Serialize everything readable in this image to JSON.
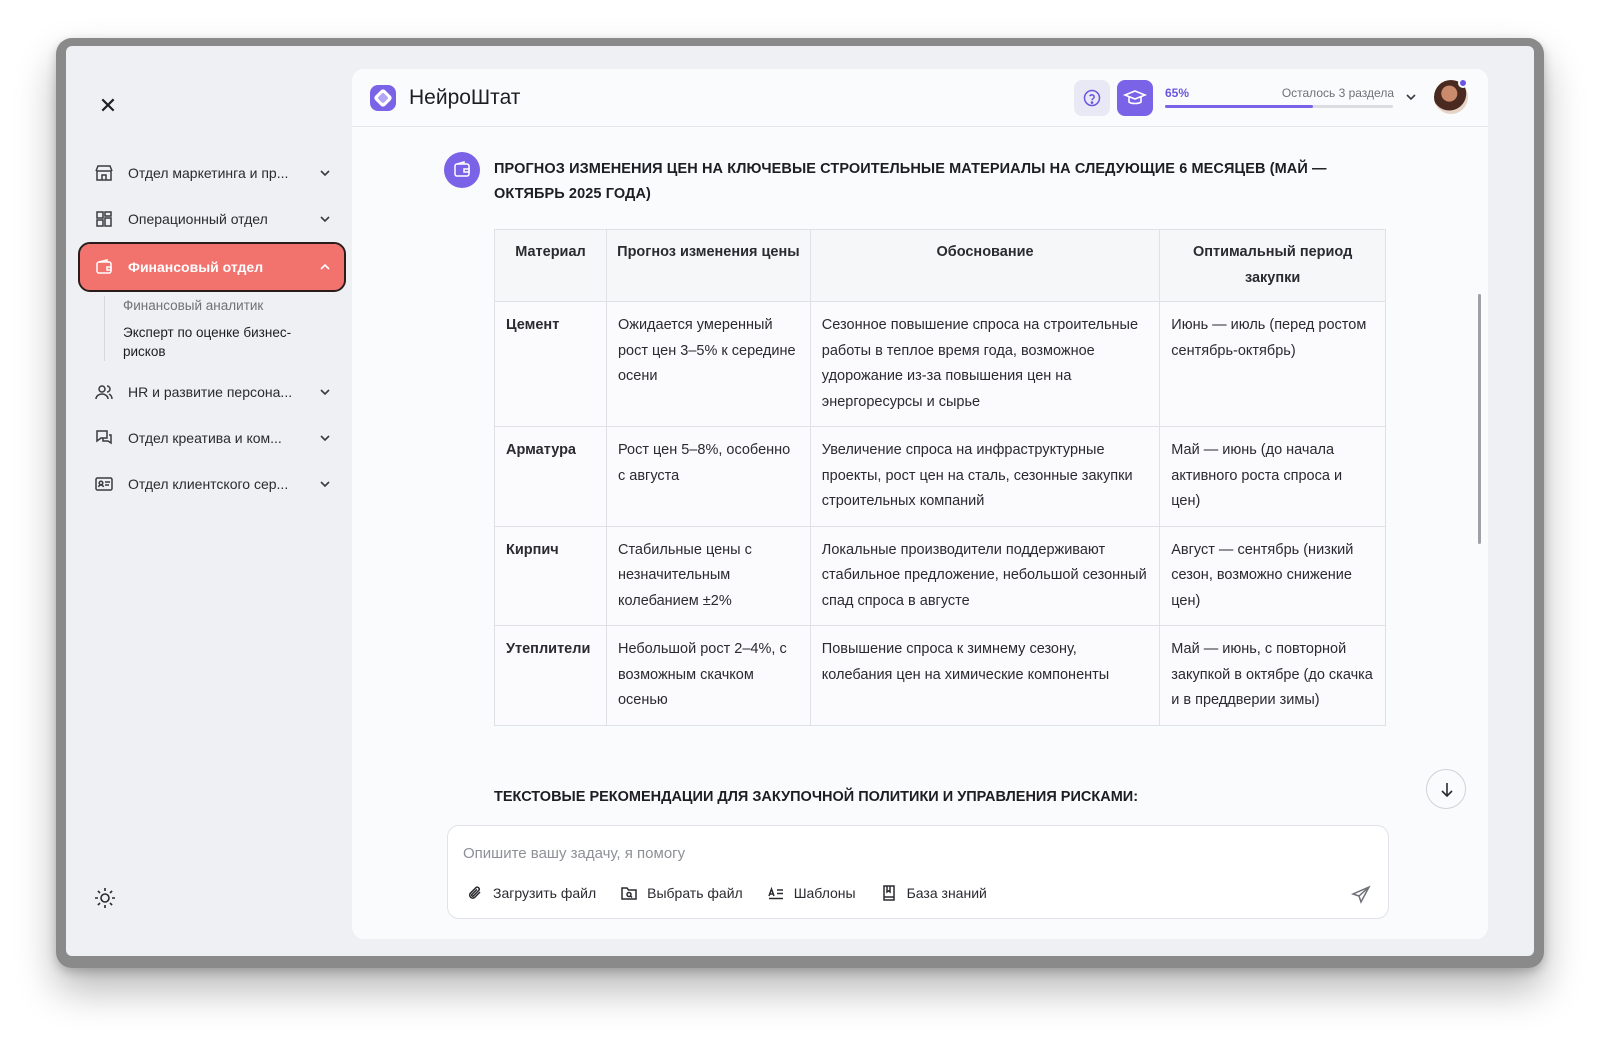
{
  "sidebar": {
    "items": [
      {
        "label": "Отдел маркетинга и пр...",
        "icon": "store-icon"
      },
      {
        "label": "Операционный отдел",
        "icon": "grid-icon"
      },
      {
        "label": "Финансовый отдел",
        "icon": "wallet-icon",
        "active": true
      },
      {
        "label": "HR и развитие персона...",
        "icon": "users-icon"
      },
      {
        "label": "Отдел креатива и ком...",
        "icon": "chat-icon"
      },
      {
        "label": "Отдел клиентского сер...",
        "icon": "id-card-icon"
      }
    ],
    "sub_items": [
      {
        "label": "Финансовый аналитик"
      },
      {
        "label": "Эксперт по оценке бизнес-рисков"
      }
    ]
  },
  "header": {
    "brand": "НейроШтат",
    "progress_pct_label": "65%",
    "progress_value": 0.65,
    "progress_remaining": "Осталось 3 раздела"
  },
  "content": {
    "heading": "ПРОГНОЗ ИЗМЕНЕНИЯ ЦЕН НА КЛЮЧЕВЫЕ СТРОИТЕЛЬНЫЕ МАТЕРИАЛЫ НА СЛЕДУЮЩИЕ 6 МЕСЯЦЕВ (МАЙ — ОКТЯБРЬ 2025 ГОДА)",
    "table": {
      "headers": [
        "Материал",
        "Прогноз изменения цены",
        "Обоснование",
        "Оптимальный период закупки"
      ],
      "rows": [
        [
          "Цемент",
          "Ожидается умеренный рост цен 3–5% к середине осени",
          "Сезонное повышение спроса на строительные работы в теплое время года, возможное удорожание из-за повышения цен на энергоресурсы и сырье",
          "Июнь — июль (перед ростом сентябрь-октябрь)"
        ],
        [
          "Арматура",
          "Рост цен 5–8%, особенно с августа",
          "Увеличение спроса на инфраструктурные проекты, рост цен на сталь, сезонные закупки строительных компаний",
          "Май — июнь (до начала активного роста спроса и цен)"
        ],
        [
          "Кирпич",
          "Стабильные цены с незначительным колебанием ±2%",
          "Локальные производители поддерживают стабильное предложение, небольшой сезонный спад спроса в августе",
          "Август — сентябрь (низкий сезон, возможно снижение цен)"
        ],
        [
          "Утеплители",
          "Небольшой рост 2–4%, с возможным скачком осенью",
          "Повышение спроса к зимнему сезону, колебания цен на химические компоненты",
          "Май — июнь, с повторной закупкой в октябре (до скачка и в преддверии зимы)"
        ]
      ]
    },
    "rec_heading": "ТЕКСТОВЫЕ РЕКОМЕНДАЦИИ ДЛЯ ЗАКУПОЧНОЙ ПОЛИТИКИ И УПРАВЛЕНИЯ РИСКАМИ:"
  },
  "composer": {
    "placeholder": "Опишите вашу задачу, я помогу",
    "value": "",
    "tools": [
      {
        "label": "Загрузить файл",
        "icon": "paperclip-icon"
      },
      {
        "label": "Выбрать файл",
        "icon": "file-search-icon"
      },
      {
        "label": "Шаблоны",
        "icon": "template-icon"
      },
      {
        "label": "База знаний",
        "icon": "book-icon"
      }
    ]
  },
  "colors": {
    "accent": "#7a63e6",
    "active_nav": "#f2726d",
    "panel": "#fafbfc",
    "background": "#eef0f3"
  }
}
